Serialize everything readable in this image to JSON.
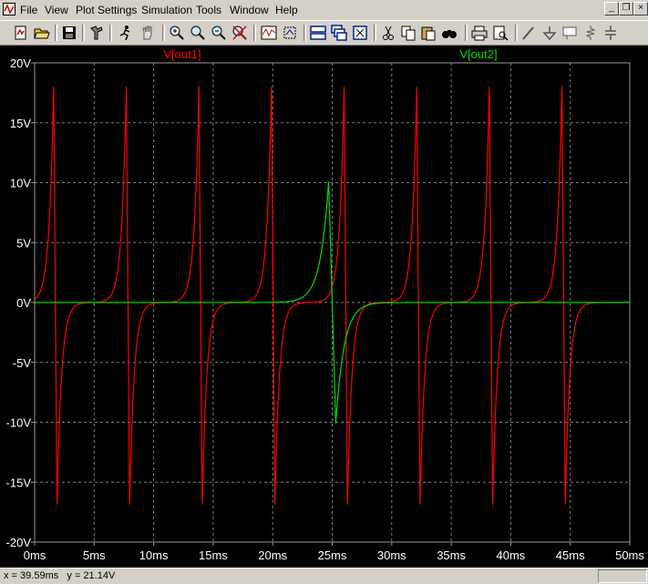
{
  "menu": {
    "items": [
      "File",
      "View",
      "Plot Settings",
      "Simulation",
      "Tools",
      "Window",
      "Help"
    ]
  },
  "window_controls": {
    "minimize": "_",
    "restore": "❐",
    "close": "×"
  },
  "toolbar": {
    "icons": [
      "new-schematic-icon",
      "open-icon",
      "save-icon",
      "control-panel-icon",
      "run-icon",
      "halt-icon",
      "zoom-area-icon",
      "zoom-in-icon",
      "zoom-out-icon",
      "zoom-cancel-icon",
      "autorange-icon",
      "fit-icon",
      "tile-horizontal-icon",
      "cascade-icon",
      "close-all-icon",
      "cut-icon",
      "copy-icon",
      "paste-icon",
      "find-icon",
      "print-icon",
      "print-preview-icon",
      "draw-wire-icon",
      "ground-icon",
      "label-net-icon",
      "resistor-icon",
      "capacitor-icon"
    ]
  },
  "status": {
    "text": "x = 39.59ms   y = 21.14V"
  },
  "chart_data": {
    "type": "line",
    "x_unit": "ms",
    "y_unit": "V",
    "xlim": [
      0,
      50
    ],
    "ylim": [
      -20,
      20
    ],
    "x_ticks": [
      "0ms",
      "5ms",
      "10ms",
      "15ms",
      "20ms",
      "25ms",
      "30ms",
      "35ms",
      "40ms",
      "45ms",
      "50ms"
    ],
    "y_ticks": [
      "20V",
      "15V",
      "10V",
      "5V",
      "0V",
      "-5V",
      "-10V",
      "-15V",
      "-20V"
    ],
    "grid": true,
    "series": [
      {
        "name": "V[out1]",
        "color": "#ff0000",
        "shape": "periodic-spikes",
        "period_ms": 6.1,
        "first_positive_peak_ms": 1.6,
        "positive_peak": 18,
        "negative_peak": -17,
        "positive_peak_times_ms": [
          1.6,
          7.7,
          13.8,
          19.9,
          26.0,
          32.1,
          38.2,
          44.3
        ],
        "negative_peak_times_ms": [
          1.9,
          8.0,
          14.1,
          20.2,
          26.3,
          32.4,
          38.5,
          44.6
        ]
      },
      {
        "name": "V[out2]",
        "color": "#00dd00",
        "shape": "single-bipolar-pulse",
        "positive_peak_time_ms": 24.7,
        "positive_peak": 10.1,
        "negative_peak_time_ms": 25.3,
        "negative_peak": -10.1
      }
    ]
  }
}
